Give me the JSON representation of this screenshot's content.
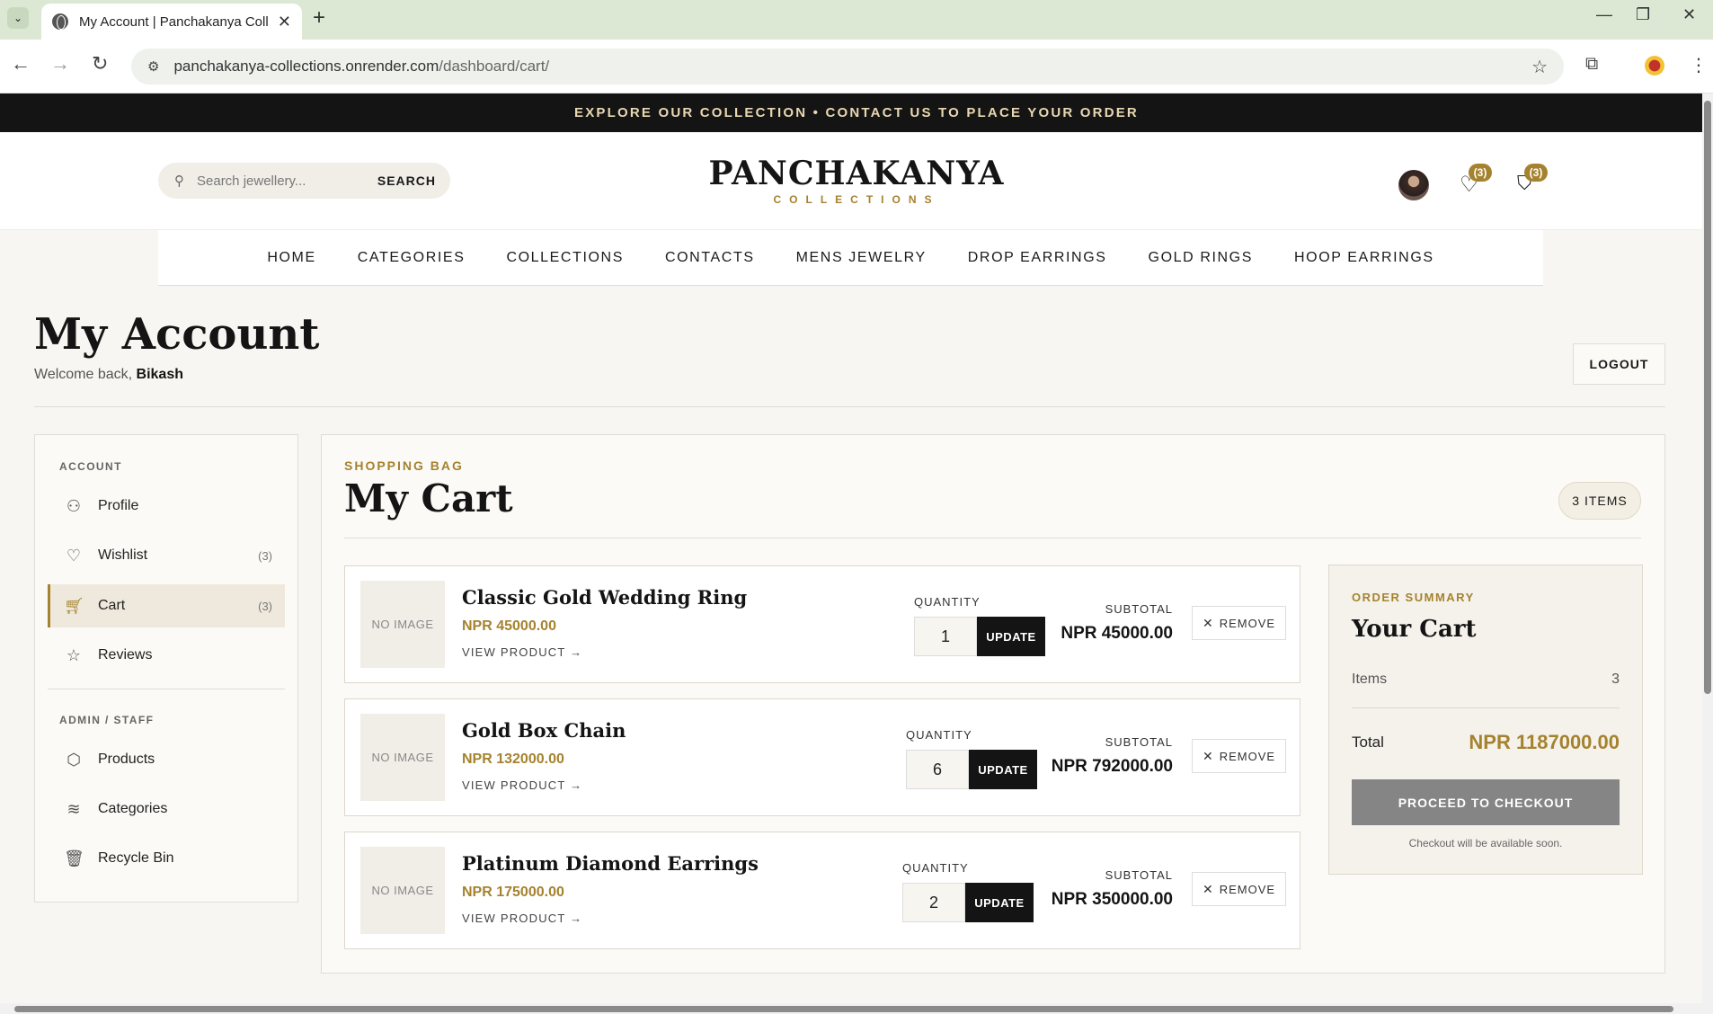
{
  "browser": {
    "tab_title": "My Account | Panchakanya Coll",
    "url_domain": "panchakanya-collections.onrender.com",
    "url_path": "/dashboard/cart/"
  },
  "site": {
    "announcement": "EXPLORE OUR COLLECTION • CONTACT US TO PLACE YOUR ORDER",
    "search_placeholder": "Search jewellery...",
    "search_button": "SEARCH",
    "logo_main": "PANCHAKANYA",
    "logo_sub": "COLLECTIONS",
    "wishlist_badge": "(3)",
    "cart_badge": "(3)",
    "nav": [
      "HOME",
      "CATEGORIES",
      "COLLECTIONS",
      "CONTACTS",
      "MENS JEWELRY",
      "DROP EARRINGS",
      "GOLD RINGS",
      "HOOP EARRINGS"
    ]
  },
  "account": {
    "title": "My Account",
    "welcome_prefix": "Welcome back,",
    "user_name": "Bikash",
    "logout": "LOGOUT"
  },
  "sidebar": {
    "account_heading": "ACCOUNT",
    "admin_heading": "ADMIN / STAFF",
    "items": [
      {
        "label": "Profile",
        "count": ""
      },
      {
        "label": "Wishlist",
        "count": "(3)"
      },
      {
        "label": "Cart",
        "count": "(3)"
      },
      {
        "label": "Reviews",
        "count": ""
      }
    ],
    "admin_items": [
      {
        "label": "Products"
      },
      {
        "label": "Categories"
      },
      {
        "label": "Recycle Bin"
      }
    ]
  },
  "cart": {
    "eyebrow": "SHOPPING BAG",
    "title": "My Cart",
    "item_count": "3 ITEMS",
    "no_image": "NO IMAGE",
    "view_product": "VIEW PRODUCT →",
    "quantity_label": "QUANTITY",
    "update_label": "UPDATE",
    "subtotal_label": "SUBTOTAL",
    "remove_label": "REMOVE",
    "items": [
      {
        "name": "Classic Gold Wedding Ring",
        "price": "NPR 45000.00",
        "quantity": "1",
        "subtotal": "NPR 45000.00"
      },
      {
        "name": "Gold Box Chain",
        "price": "NPR 132000.00",
        "quantity": "6",
        "subtotal": "NPR 792000.00"
      },
      {
        "name": "Platinum Diamond Earrings",
        "price": "NPR 175000.00",
        "quantity": "2",
        "subtotal": "NPR 350000.00"
      }
    ]
  },
  "summary": {
    "eyebrow": "ORDER SUMMARY",
    "title": "Your Cart",
    "items_label": "Items",
    "items_value": "3",
    "total_label": "Total",
    "total_value": "NPR 1187000.00",
    "checkout": "PROCEED TO CHECKOUT",
    "note": "Checkout will be available soon."
  },
  "colors": {
    "accent_gold": "#a5822e",
    "dark": "#141414",
    "checkout_disabled": "#858585"
  }
}
